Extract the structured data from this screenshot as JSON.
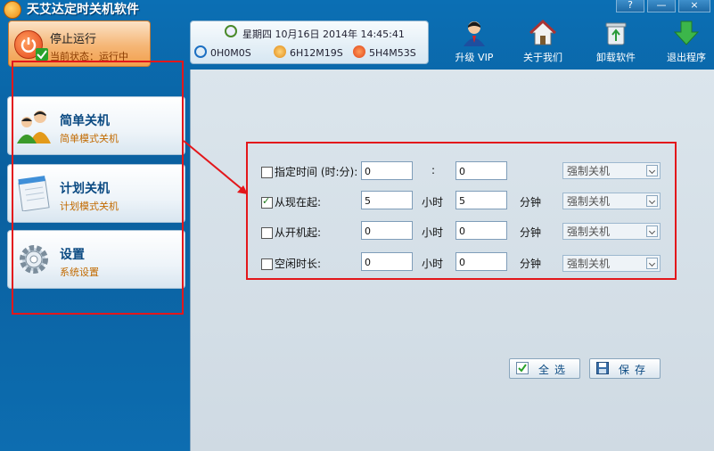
{
  "app": {
    "title": "天艾达定时关机软件",
    "help_label": "?",
    "minimize_label": "—",
    "close_label": "×"
  },
  "stop": {
    "label": "停止运行",
    "status": "当前状态：运行中"
  },
  "status": {
    "clock": "星期四 10月16日 2014年 14:45:41",
    "timers": [
      "0H0M0S",
      "6H12M19S",
      "5H4M53S"
    ]
  },
  "toolbar": [
    {
      "label": "升级 VIP",
      "icon": "vip-user-icon"
    },
    {
      "label": "关于我们",
      "icon": "house-icon"
    },
    {
      "label": "卸载软件",
      "icon": "recycle-bin-icon"
    },
    {
      "label": "退出程序",
      "icon": "exit-arrow-icon"
    }
  ],
  "sidebar": [
    {
      "title": "简单关机",
      "subtitle": "简单模式关机",
      "icon": "people-icon"
    },
    {
      "title": "计划关机",
      "subtitle": "计划模式关机",
      "icon": "notepad-icon"
    },
    {
      "title": "设置",
      "subtitle": "系统设置",
      "icon": "gear-icon"
    }
  ],
  "rows": [
    {
      "label": "指定时间 (时:分):",
      "checked": false,
      "hour": "0",
      "sep": ":",
      "minute": "0",
      "minute_unit": "",
      "action": "强制关机"
    },
    {
      "label": "从现在起:",
      "checked": true,
      "hour": "5",
      "sep": "小时",
      "minute": "5",
      "minute_unit": "分钟",
      "action": "强制关机"
    },
    {
      "label": "从开机起:",
      "checked": false,
      "hour": "0",
      "sep": "小时",
      "minute": "0",
      "minute_unit": "分钟",
      "action": "强制关机"
    },
    {
      "label": "空闲时长:",
      "checked": false,
      "hour": "0",
      "sep": "小时",
      "minute": "0",
      "minute_unit": "分钟",
      "action": "强制关机"
    }
  ],
  "buttons": {
    "select_all": "全选",
    "save": "保存"
  },
  "colors": {
    "accent_blue": "#0b6fb4",
    "annotation_red": "#e3171b",
    "stop_orange": "#f2a04d"
  }
}
